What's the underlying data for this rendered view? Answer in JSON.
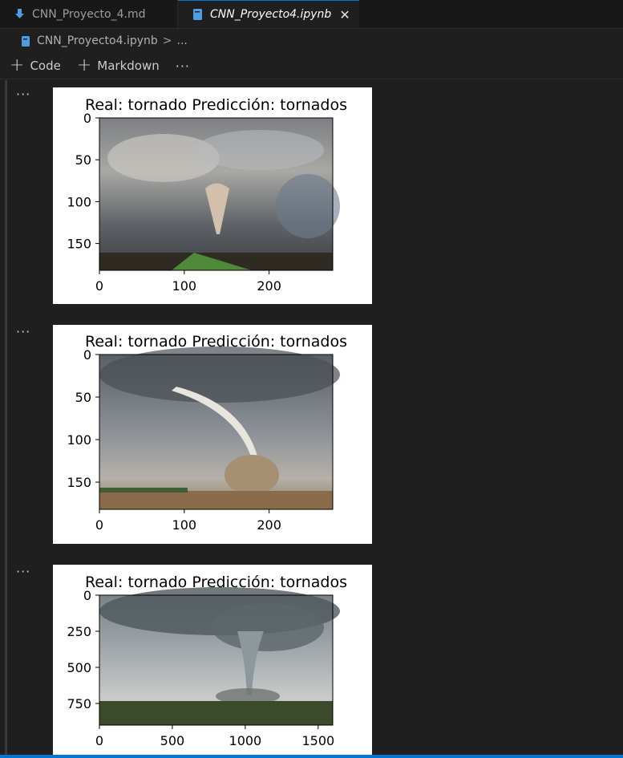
{
  "tabs": [
    {
      "label": "CNN_Proyecto_4.md",
      "active": false,
      "icon": "download-arrow-icon"
    },
    {
      "label": "CNN_Proyecto4.ipynb",
      "active": true,
      "icon": "notebook-file-icon",
      "close": "✕"
    }
  ],
  "breadcrumb": {
    "file": "CNN_Proyecto4.ipynb",
    "separator": ">",
    "rest": "..."
  },
  "toolbar": {
    "code_label": "Code",
    "markdown_label": "Markdown",
    "more": "···"
  },
  "cells": [
    {
      "more": "···",
      "chart_data": {
        "type": "image",
        "title": "Real: tornado  Predicción: tornados",
        "xlim": [
          0,
          275
        ],
        "ylim": [
          182,
          0
        ],
        "xticks": [
          0,
          100,
          200
        ],
        "yticks": [
          0,
          50,
          100,
          150
        ],
        "xtick_labels": [
          "0",
          "100",
          "200"
        ],
        "ytick_labels": [
          "0",
          "50",
          "100",
          "150"
        ]
      }
    },
    {
      "more": "···",
      "chart_data": {
        "type": "image",
        "title": "Real: tornado  Predicción: tornados",
        "xlim": [
          0,
          275
        ],
        "ylim": [
          182,
          0
        ],
        "xticks": [
          0,
          100,
          200
        ],
        "yticks": [
          0,
          50,
          100,
          150
        ],
        "xtick_labels": [
          "0",
          "100",
          "200"
        ],
        "ytick_labels": [
          "0",
          "50",
          "100",
          "150"
        ]
      }
    },
    {
      "more": "···",
      "chart_data": {
        "type": "image",
        "title": "Real: tornado  Predicción: tornados",
        "xlim": [
          0,
          1600
        ],
        "ylim": [
          900,
          0
        ],
        "xticks": [
          0,
          500,
          1000,
          1500
        ],
        "yticks": [
          0,
          250,
          500,
          750
        ],
        "xtick_labels": [
          "0",
          "500",
          "1000",
          "1500"
        ],
        "ytick_labels": [
          "0",
          "250",
          "500",
          "750"
        ]
      }
    }
  ]
}
